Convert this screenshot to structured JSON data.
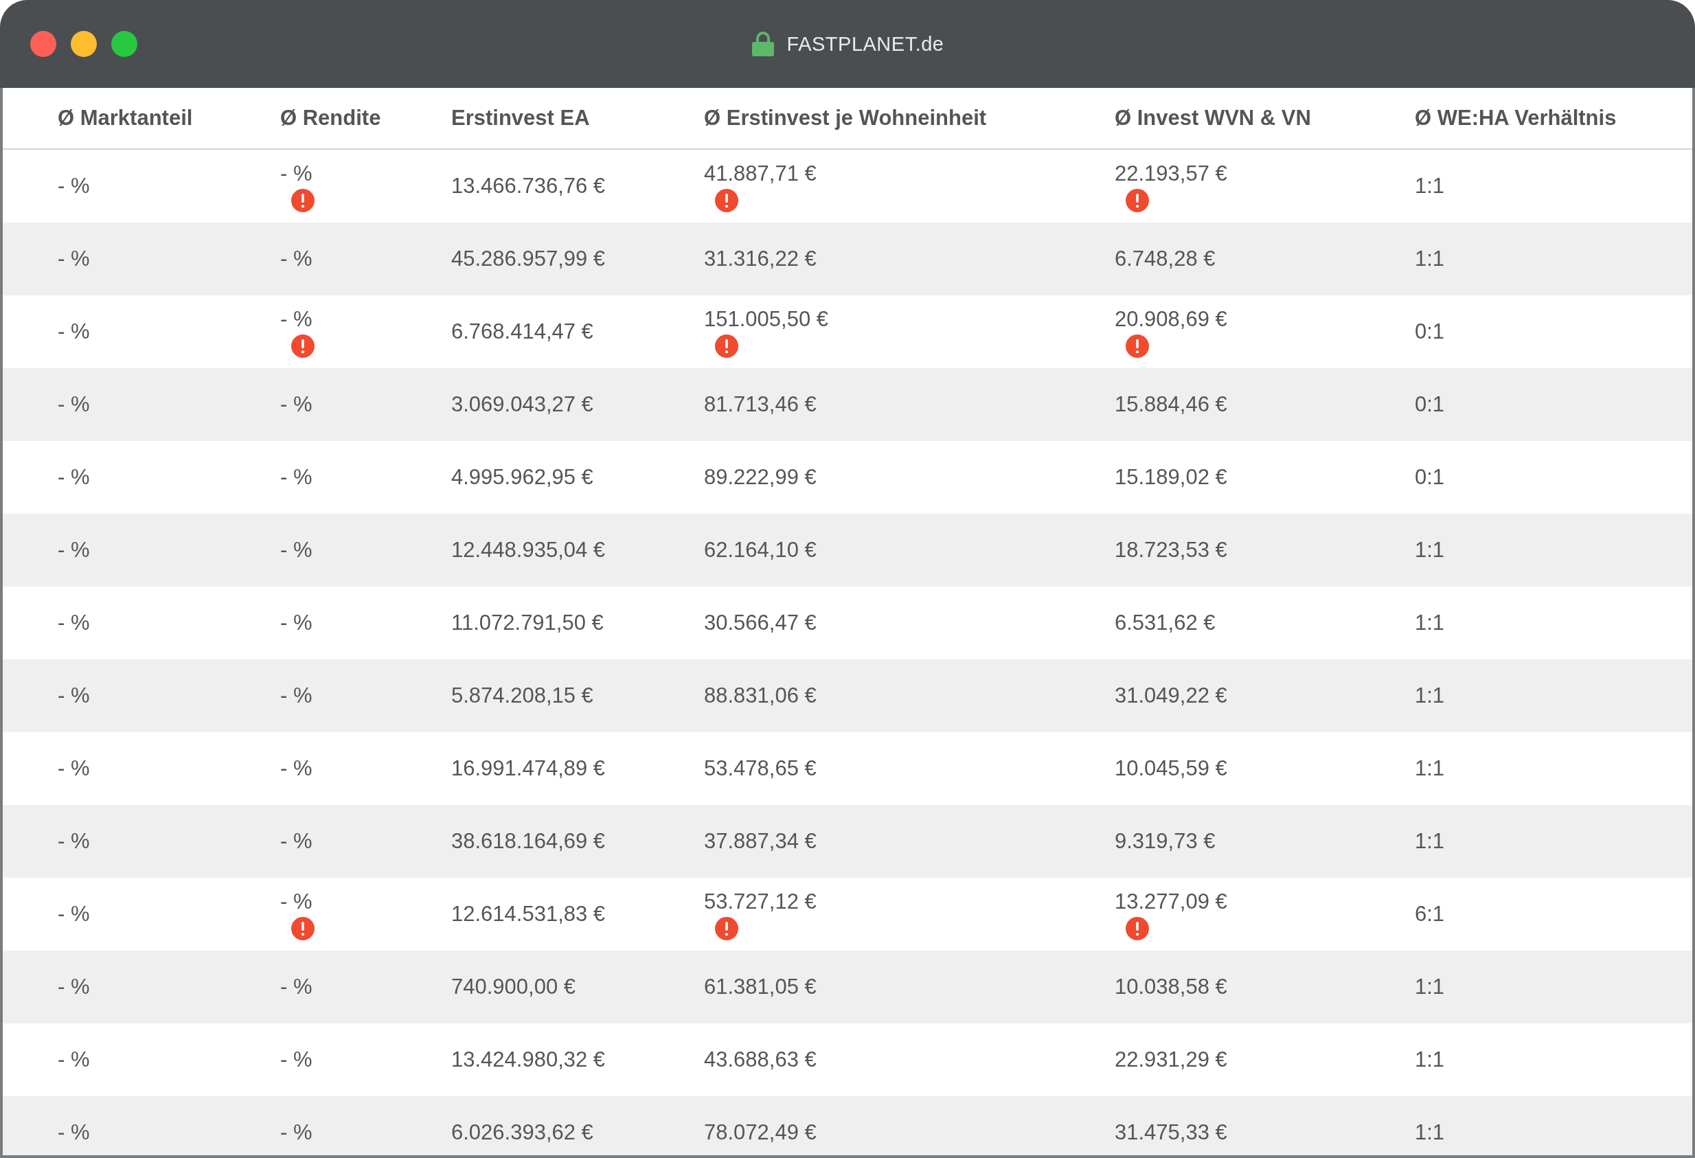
{
  "window": {
    "title": "FASTPLANET.de"
  },
  "table": {
    "columns": [
      "Ø Marktanteil",
      "Ø Rendite",
      "Erstinvest EA",
      "Ø Erstinvest je Wohneinheit",
      "Ø Invest WVN & VN",
      "Ø WE:HA Verhältnis"
    ],
    "rows": [
      {
        "warning": true,
        "cells": [
          "- %",
          "- %",
          "13.466.736,76 €",
          "41.887,71 €",
          "22.193,57 €",
          "1:1"
        ]
      },
      {
        "warning": false,
        "cells": [
          "- %",
          "- %",
          "45.286.957,99 €",
          "31.316,22 €",
          "6.748,28 €",
          "1:1"
        ]
      },
      {
        "warning": true,
        "cells": [
          "- %",
          "- %",
          "6.768.414,47 €",
          "151.005,50 €",
          "20.908,69 €",
          "0:1"
        ]
      },
      {
        "warning": false,
        "cells": [
          "- %",
          "- %",
          "3.069.043,27 €",
          "81.713,46 €",
          "15.884,46 €",
          "0:1"
        ]
      },
      {
        "warning": false,
        "cells": [
          "- %",
          "- %",
          "4.995.962,95 €",
          "89.222,99 €",
          "15.189,02 €",
          "0:1"
        ]
      },
      {
        "warning": false,
        "cells": [
          "- %",
          "- %",
          "12.448.935,04 €",
          "62.164,10 €",
          "18.723,53 €",
          "1:1"
        ]
      },
      {
        "warning": false,
        "cells": [
          "- %",
          "- %",
          "11.072.791,50 €",
          "30.566,47 €",
          "6.531,62 €",
          "1:1"
        ]
      },
      {
        "warning": false,
        "cells": [
          "- %",
          "- %",
          "5.874.208,15 €",
          "88.831,06 €",
          "31.049,22 €",
          "1:1"
        ]
      },
      {
        "warning": false,
        "cells": [
          "- %",
          "- %",
          "16.991.474,89 €",
          "53.478,65 €",
          "10.045,59 €",
          "1:1"
        ]
      },
      {
        "warning": false,
        "cells": [
          "- %",
          "- %",
          "38.618.164,69 €",
          "37.887,34 €",
          "9.319,73 €",
          "1:1"
        ]
      },
      {
        "warning": true,
        "cells": [
          "- %",
          "- %",
          "12.614.531,83 €",
          "53.727,12 €",
          "13.277,09 €",
          "6:1"
        ]
      },
      {
        "warning": false,
        "cells": [
          "- %",
          "- %",
          "740.900,00 €",
          "61.381,05 €",
          "10.038,58 €",
          "1:1"
        ]
      },
      {
        "warning": false,
        "cells": [
          "- %",
          "- %",
          "13.424.980,32 €",
          "43.688,63 €",
          "22.931,29 €",
          "1:1"
        ]
      },
      {
        "warning": false,
        "cells": [
          "- %",
          "- %",
          "6.026.393,62 €",
          "78.072,49 €",
          "31.475,33 €",
          "1:1"
        ]
      }
    ]
  }
}
